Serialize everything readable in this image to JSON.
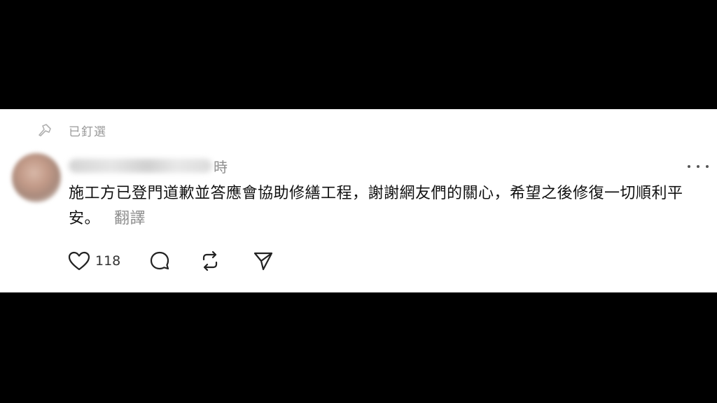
{
  "pinned": {
    "label": "已釘選",
    "icon": "pin-icon"
  },
  "post": {
    "author_blurred": true,
    "timestamp_suffix": "時",
    "text": "施工方已登門道歉並答應會協助修繕工程，謝謝網友們的關心，希望之後修復一切順利平安。",
    "translate_label": "翻譯"
  },
  "actions": {
    "like_icon": "heart-icon",
    "like_count": "118",
    "reply_icon": "comment-icon",
    "repost_icon": "repost-icon",
    "share_icon": "send-icon"
  },
  "menu": {
    "icon": "more-icon"
  },
  "colors": {
    "background_bars": "#000000",
    "card": "#ffffff",
    "text_primary": "#111111",
    "text_secondary": "#8e8e8e"
  }
}
